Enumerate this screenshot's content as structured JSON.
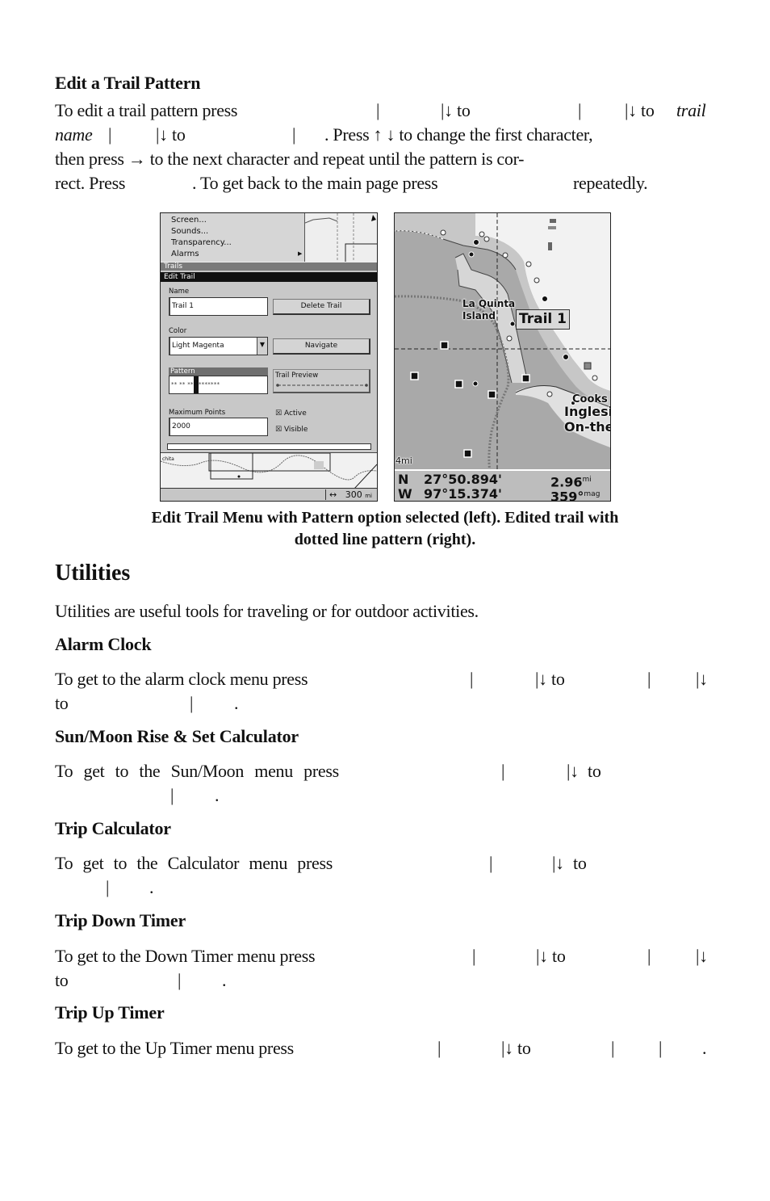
{
  "edit_trail_pattern": {
    "heading": "Edit a Trail Pattern",
    "line1_a": "To edit a trail pattern press",
    "sep": "|",
    "down_to": "|↓ to",
    "trail_name_italic_a": "trail",
    "trail_name_italic_b": "name",
    "line2_mid": ". Press ↑ ↓ to change the first character,",
    "line3": "then press → to the next character and repeat until the pattern is cor-",
    "line4_a": "rect. Press",
    "line4_b": ". To get back to the main page press",
    "line4_c": "repeatedly."
  },
  "left_screenshot": {
    "menu_items": [
      "Screen...",
      "Sounds...",
      "Transparency...",
      "Alarms"
    ],
    "trails_bar": "Trails",
    "edit_trail_bar": "Edit Trail",
    "name_label": "Name",
    "name_value": "Trail 1",
    "delete_button": "Delete Trail",
    "color_label": "Color",
    "color_value": "Light Magenta",
    "navigate_button": "Navigate",
    "pattern_label": "Pattern",
    "pattern_value_a": "** ** **",
    "pattern_value_b": "*******",
    "trail_preview_label": "Trail Preview",
    "max_points_label": "Maximum Points",
    "max_points_value": "2000",
    "active_label": "Active",
    "active_checked": true,
    "visible_label": "Visible",
    "visible_checked": true,
    "checkbox_glyph": "☒",
    "map_place": "chita",
    "scale_value": "300",
    "scale_unit": "mi",
    "scale_icon": "↔"
  },
  "right_screenshot": {
    "place_la_quinta": "La Quinta",
    "place_island": "Island",
    "trail_label": "Trail 1",
    "place_cooks": "Cooks",
    "place_inglesi": "Inglesi",
    "place_onthe": "On-the",
    "zoom_scale": "4mi",
    "lat_dir": "N",
    "lat_value": "27°50.894'",
    "lon_dir": "W",
    "lon_value": "97°15.374'",
    "distance_value": "2.96",
    "distance_unit": "mi",
    "bearing_value": "359°",
    "bearing_unit": "mag"
  },
  "caption": {
    "line1": "Edit Trail Menu with Pattern option selected (left). Edited trail with",
    "line2": "dotted line pattern (right)."
  },
  "utilities": {
    "title": "Utilities",
    "intro": "Utilities are useful tools for traveling or for outdoor activities.",
    "sections": [
      {
        "heading": "Alarm Clock",
        "text": "To get to the alarm clock menu press"
      },
      {
        "heading": "Sun/Moon Rise & Set Calculator",
        "text": "To get to the Sun/Moon menu press"
      },
      {
        "heading": "Trip Calculator",
        "text": "To get to the Calculator menu press"
      },
      {
        "heading": "Trip Down Timer",
        "text": "To get to the Down Timer menu press"
      },
      {
        "heading": "Trip Up Timer",
        "text": "To get to the Up Timer menu press"
      }
    ],
    "to": "to",
    "down_to": "|↓ to",
    "down": "|↓",
    "sep": "|",
    "period": "."
  }
}
